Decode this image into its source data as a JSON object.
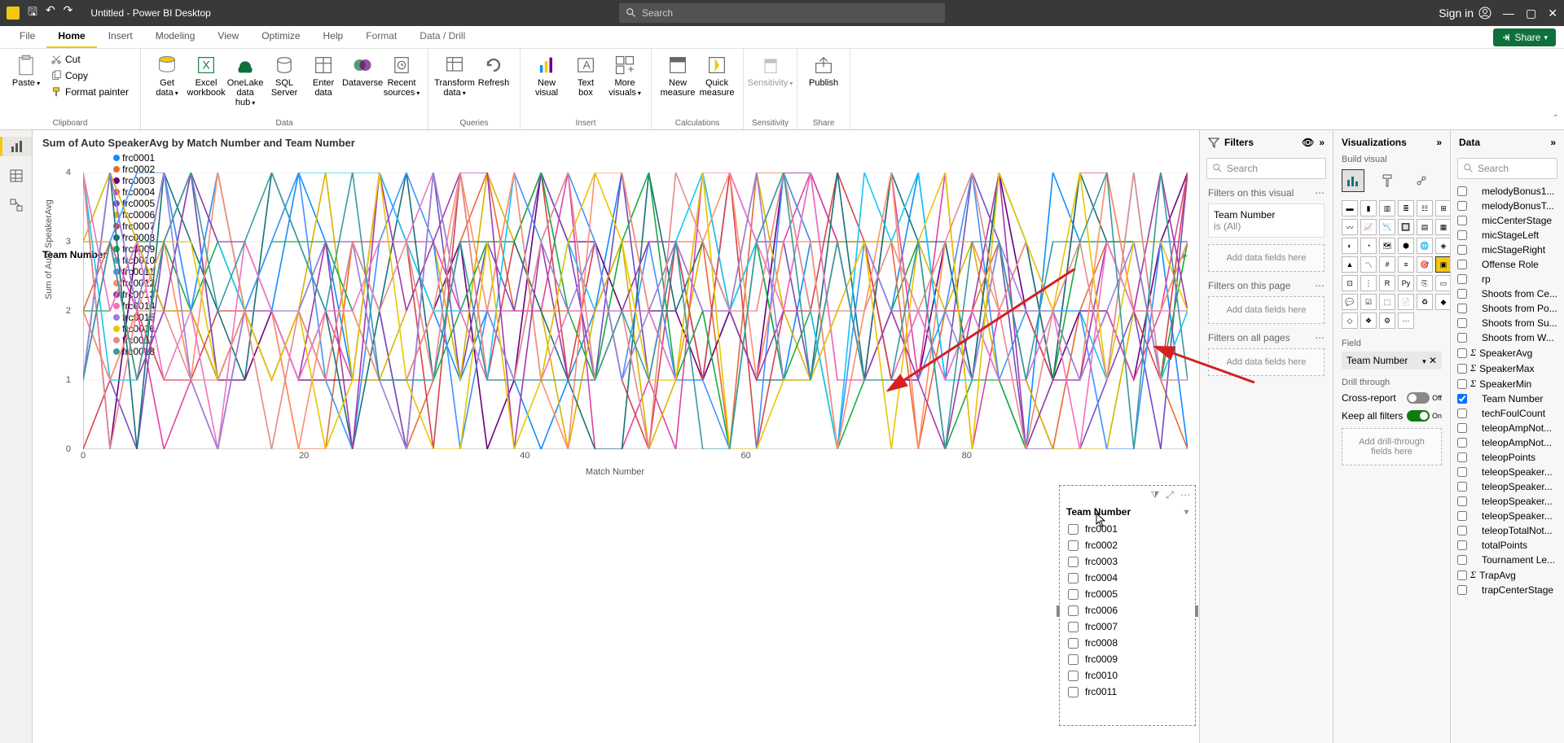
{
  "titlebar": {
    "title": "Untitled - Power BI Desktop",
    "search_ph": "Search",
    "signin": "Sign in"
  },
  "tabs": [
    "File",
    "Home",
    "Insert",
    "Modeling",
    "View",
    "Optimize",
    "Help",
    "Format",
    "Data / Drill"
  ],
  "active_tab": "Home",
  "share": "Share",
  "ribbon": {
    "clipboard": {
      "label": "Clipboard",
      "paste": "Paste",
      "cut": "Cut",
      "copy": "Copy",
      "fmt": "Format painter"
    },
    "data": {
      "label": "Data",
      "get": "Get data",
      "excel": "Excel workbook",
      "onelake": "OneLake data hub",
      "sql": "SQL Server",
      "enter": "Enter data",
      "dataverse": "Dataverse",
      "recent": "Recent sources"
    },
    "queries": {
      "label": "Queries",
      "transform": "Transform data",
      "refresh": "Refresh"
    },
    "insert": {
      "label": "Insert",
      "visual": "New visual",
      "text": "Text box",
      "more": "More visuals"
    },
    "calc": {
      "label": "Calculations",
      "measure": "New measure",
      "quick": "Quick measure"
    },
    "sens": {
      "label": "Sensitivity",
      "btn": "Sensitivity"
    },
    "share": {
      "label": "Share",
      "btn": "Publish"
    }
  },
  "chart": {
    "title": "Sum of Auto SpeakerAvg by Match Number and Team Number",
    "legend_label": "Team Number",
    "xlabel": "Match Number",
    "ylabel": "Sum of Auto SpeakerAvg",
    "legend": [
      {
        "name": "frc0001",
        "c": "#118dff"
      },
      {
        "name": "frc0002",
        "c": "#e66c37"
      },
      {
        "name": "frc0003",
        "c": "#6b007b"
      },
      {
        "name": "frc0004",
        "c": "#e044a7"
      },
      {
        "name": "frc0005",
        "c": "#744ec2"
      },
      {
        "name": "frc0006",
        "c": "#d9b300"
      },
      {
        "name": "frc0007",
        "c": "#d64550"
      },
      {
        "name": "frc0008",
        "c": "#197278"
      },
      {
        "name": "frc0009",
        "c": "#1aab40"
      },
      {
        "name": "frc0010",
        "c": "#15c6f4"
      },
      {
        "name": "frc0011",
        "c": "#4092ff"
      },
      {
        "name": "frc0012",
        "c": "#ff8f6b"
      },
      {
        "name": "frc0013",
        "c": "#a43aae"
      },
      {
        "name": "frc0014",
        "c": "#f272c2"
      },
      {
        "name": "frc0015",
        "c": "#9a7ed8"
      },
      {
        "name": "frc0016",
        "c": "#e8c600"
      },
      {
        "name": "frc0017",
        "c": "#e68a8a"
      },
      {
        "name": "frc0018",
        "c": "#3a9b9f"
      }
    ]
  },
  "chart_data": {
    "type": "line",
    "title": "Sum of Auto SpeakerAvg by Match Number and Team Number",
    "xlabel": "Match Number",
    "ylabel": "Sum of Auto SpeakerAvg",
    "ylim": [
      0,
      4
    ],
    "xlim": [
      0,
      100
    ],
    "x_ticks": [
      0,
      20,
      40,
      60,
      80
    ],
    "y_ticks": [
      0,
      1,
      2,
      3,
      4
    ],
    "series_count": 18,
    "note": "Dense multi-series line chart; individual point values not legible from screenshot — 18 team series ranging 0–4 across ~100 matches"
  },
  "slicer": {
    "title": "Team Number",
    "items": [
      "frc0001",
      "frc0002",
      "frc0003",
      "frc0004",
      "frc0005",
      "frc0006",
      "frc0007",
      "frc0008",
      "frc0009",
      "frc0010",
      "frc0011"
    ]
  },
  "filters": {
    "title": "Filters",
    "search_ph": "Search",
    "visual_lbl": "Filters on this visual",
    "page_lbl": "Filters on this page",
    "all_lbl": "Filters on all pages",
    "card_field": "Team Number",
    "card_val": "is (All)",
    "drop": "Add data fields here"
  },
  "viz": {
    "title": "Visualizations",
    "sub": "Build visual",
    "field_lbl": "Field",
    "field_val": "Team Number",
    "drill_lbl": "Drill through",
    "cross": "Cross-report",
    "cross_state": "Off",
    "keep": "Keep all filters",
    "keep_state": "On",
    "drill_drop": "Add drill-through fields here"
  },
  "data": {
    "title": "Data",
    "search_ph": "Search",
    "fields": [
      {
        "n": "melodyBonus1...",
        "sig": false,
        "chk": false
      },
      {
        "n": "melodyBonusT...",
        "sig": false,
        "chk": false
      },
      {
        "n": "micCenterStage",
        "sig": false,
        "chk": false
      },
      {
        "n": "micStageLeft",
        "sig": false,
        "chk": false
      },
      {
        "n": "micStageRight",
        "sig": false,
        "chk": false
      },
      {
        "n": "Offense Role",
        "sig": false,
        "chk": false
      },
      {
        "n": "rp",
        "sig": false,
        "chk": false
      },
      {
        "n": "Shoots from Ce...",
        "sig": false,
        "chk": false
      },
      {
        "n": "Shoots from Po...",
        "sig": false,
        "chk": false
      },
      {
        "n": "Shoots from Su...",
        "sig": false,
        "chk": false
      },
      {
        "n": "Shoots from W...",
        "sig": false,
        "chk": false
      },
      {
        "n": "SpeakerAvg",
        "sig": true,
        "chk": false
      },
      {
        "n": "SpeakerMax",
        "sig": true,
        "chk": false
      },
      {
        "n": "SpeakerMin",
        "sig": true,
        "chk": false
      },
      {
        "n": "Team Number",
        "sig": false,
        "chk": true
      },
      {
        "n": "techFoulCount",
        "sig": false,
        "chk": false
      },
      {
        "n": "teleopAmpNot...",
        "sig": false,
        "chk": false
      },
      {
        "n": "teleopAmpNot...",
        "sig": false,
        "chk": false
      },
      {
        "n": "teleopPoints",
        "sig": false,
        "chk": false
      },
      {
        "n": "teleopSpeaker...",
        "sig": false,
        "chk": false
      },
      {
        "n": "teleopSpeaker...",
        "sig": false,
        "chk": false
      },
      {
        "n": "teleopSpeaker...",
        "sig": false,
        "chk": false
      },
      {
        "n": "teleopSpeaker...",
        "sig": false,
        "chk": false
      },
      {
        "n": "teleopTotalNot...",
        "sig": false,
        "chk": false
      },
      {
        "n": "totalPoints",
        "sig": false,
        "chk": false
      },
      {
        "n": "Tournament Le...",
        "sig": false,
        "chk": false
      },
      {
        "n": "TrapAvg",
        "sig": true,
        "chk": false
      },
      {
        "n": "trapCenterStage",
        "sig": false,
        "chk": false
      }
    ]
  }
}
